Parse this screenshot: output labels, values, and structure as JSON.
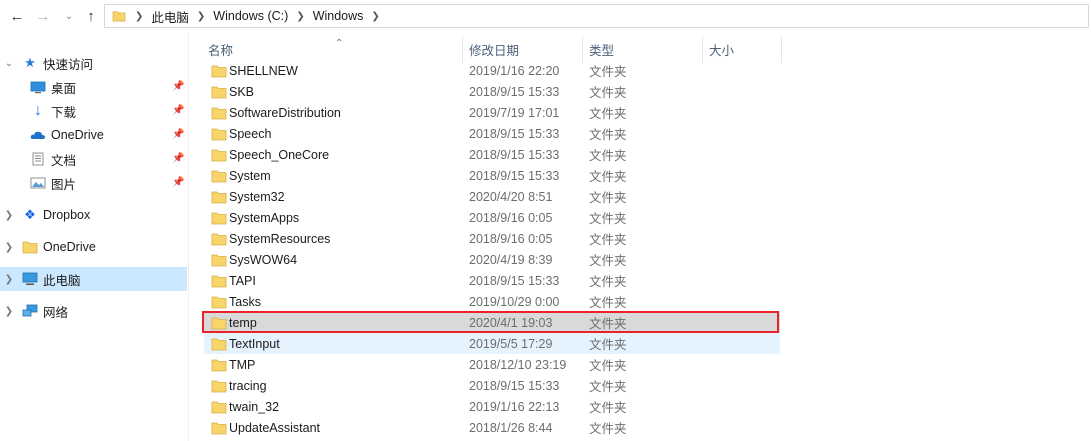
{
  "breadcrumb": [
    "此电脑",
    "Windows (C:)",
    "Windows"
  ],
  "columns": {
    "name": "名称",
    "date": "修改日期",
    "type": "类型",
    "size": "大小"
  },
  "sidebar": {
    "quick_access": "快速访问",
    "quick_items": [
      {
        "label": "桌面",
        "icon": "desktop-icon"
      },
      {
        "label": "下载",
        "icon": "download-icon"
      },
      {
        "label": "OneDrive",
        "icon": "cloud-icon"
      },
      {
        "label": "文档",
        "icon": "document-icon"
      },
      {
        "label": "图片",
        "icon": "picture-icon"
      }
    ],
    "dropbox": "Dropbox",
    "onedrive": "OneDrive",
    "this_pc": "此电脑",
    "network": "网络"
  },
  "files": [
    {
      "name": "SHELLNEW",
      "date": "2019/1/16 22:20",
      "type": "文件夹"
    },
    {
      "name": "SKB",
      "date": "2018/9/15 15:33",
      "type": "文件夹"
    },
    {
      "name": "SoftwareDistribution",
      "date": "2019/7/19 17:01",
      "type": "文件夹"
    },
    {
      "name": "Speech",
      "date": "2018/9/15 15:33",
      "type": "文件夹"
    },
    {
      "name": "Speech_OneCore",
      "date": "2018/9/15 15:33",
      "type": "文件夹"
    },
    {
      "name": "System",
      "date": "2018/9/15 15:33",
      "type": "文件夹"
    },
    {
      "name": "System32",
      "date": "2020/4/20 8:51",
      "type": "文件夹"
    },
    {
      "name": "SystemApps",
      "date": "2018/9/16 0:05",
      "type": "文件夹"
    },
    {
      "name": "SystemResources",
      "date": "2018/9/16 0:05",
      "type": "文件夹"
    },
    {
      "name": "SysWOW64",
      "date": "2020/4/19 8:39",
      "type": "文件夹"
    },
    {
      "name": "TAPI",
      "date": "2018/9/15 15:33",
      "type": "文件夹"
    },
    {
      "name": "Tasks",
      "date": "2019/10/29 0:00",
      "type": "文件夹"
    },
    {
      "name": "temp",
      "date": "2020/4/1 19:03",
      "type": "文件夹"
    },
    {
      "name": "TextInput",
      "date": "2019/5/5 17:29",
      "type": "文件夹"
    },
    {
      "name": "TMP",
      "date": "2018/12/10 23:19",
      "type": "文件夹"
    },
    {
      "name": "tracing",
      "date": "2018/9/15 15:33",
      "type": "文件夹"
    },
    {
      "name": "twain_32",
      "date": "2019/1/16 22:13",
      "type": "文件夹"
    },
    {
      "name": "UpdateAssistant",
      "date": "2018/1/26 8:44",
      "type": "文件夹"
    }
  ],
  "colors": {
    "folder": "#f8d56b",
    "selected_row": "#d9d9d9",
    "hover_row": "#e5f3ff",
    "highlight_border": "#e8232b",
    "sidebar_selected": "#cce8ff"
  }
}
